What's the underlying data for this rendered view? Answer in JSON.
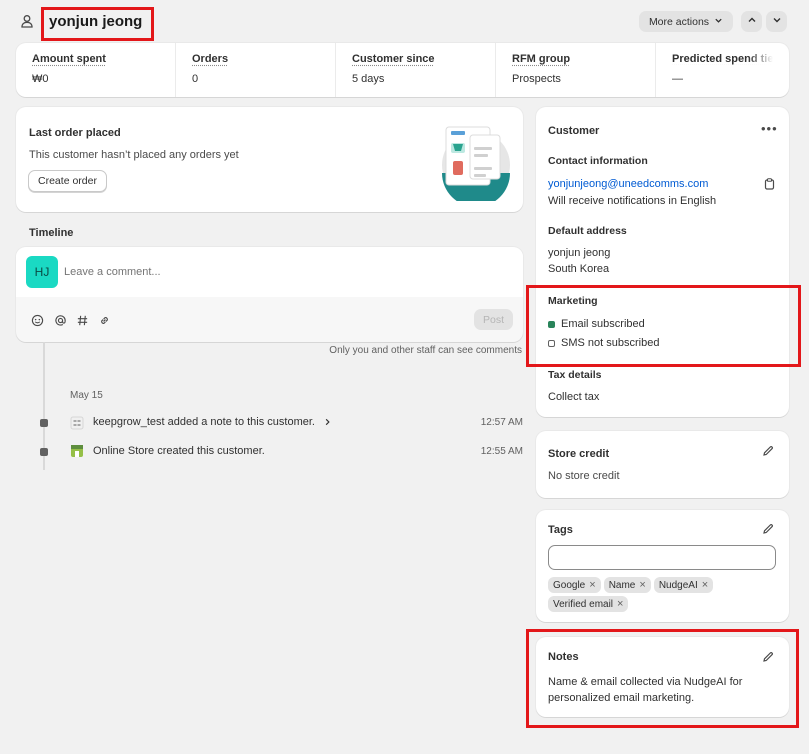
{
  "header": {
    "customer_name": "yonjun jeong",
    "more_actions_label": "More actions"
  },
  "stats": [
    {
      "label": "Amount spent",
      "value": "₩0"
    },
    {
      "label": "Orders",
      "value": "0"
    },
    {
      "label": "Customer since",
      "value": "5 days"
    },
    {
      "label": "RFM group",
      "value": "Prospects"
    },
    {
      "label": "Predicted spend tier",
      "value": "—"
    }
  ],
  "last_order": {
    "title": "Last order placed",
    "message": "This customer hasn’t placed any orders yet",
    "create_order_label": "Create order"
  },
  "timeline": {
    "title": "Timeline",
    "avatar_initials": "HJ",
    "comment_placeholder": "Leave a comment...",
    "post_label": "Post",
    "visibility_note": "Only you and other staff can see comments",
    "date": "May 15",
    "events": [
      {
        "text": "keepgrow_test added a note to this customer.",
        "time": "12:57 AM"
      },
      {
        "text": "Online Store created this customer.",
        "time": "12:55 AM"
      }
    ]
  },
  "customer": {
    "title": "Customer",
    "contact_heading": "Contact information",
    "email": "yonjunjeong@uneedcomms.com",
    "notification_language": "Will receive notifications in English",
    "address_heading": "Default address",
    "address_name": "yonjun jeong",
    "address_country": "South Korea",
    "marketing_heading": "Marketing",
    "email_status": "Email subscribed",
    "sms_status": "SMS not subscribed",
    "tax_heading": "Tax details",
    "tax_value": "Collect tax"
  },
  "store_credit": {
    "title": "Store credit",
    "value": "No store credit"
  },
  "tags": {
    "title": "Tags",
    "input_value": "",
    "items": [
      "Google",
      "Name",
      "NudgeAI",
      "Verified email"
    ]
  },
  "notes": {
    "title": "Notes",
    "text": "Name & email collected via NudgeAI for personalized email marketing."
  },
  "colors": {
    "avatar_bg": "#1ad9c3",
    "email_subscribed": "#29845a",
    "link": "#005bd3",
    "highlight": "#e3171a"
  }
}
